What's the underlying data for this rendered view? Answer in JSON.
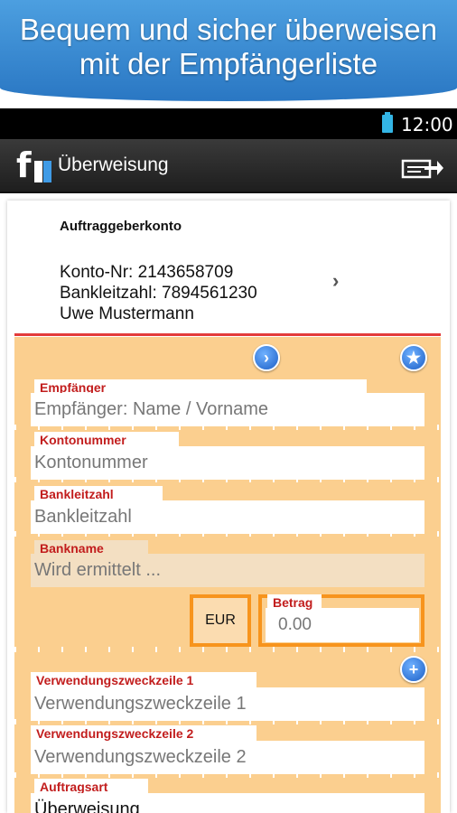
{
  "banner": {
    "line1": "Bequem und sicher überweisen",
    "line2": "mit der Empfängerliste"
  },
  "statusbar": {
    "time": "12:00",
    "battery_icon": "battery-icon"
  },
  "actionbar": {
    "title": "Überweisung",
    "logo_letter": "f"
  },
  "account": {
    "heading": "Auftraggeberkonto",
    "konto": "Konto-Nr: 2143658709",
    "blz": "Bankleitzahl: 7894561230",
    "name": "Uwe Mustermann"
  },
  "form": {
    "empfaenger": {
      "label": "Empfänger",
      "placeholder": "Empfänger: Name / Vorname"
    },
    "kontonummer": {
      "label": "Kontonummer",
      "placeholder": "Kontonummer"
    },
    "bankleitzahl": {
      "label": "Bankleitzahl",
      "placeholder": "Bankleitzahl"
    },
    "bankname": {
      "label": "Bankname",
      "value": "Wird ermittelt ..."
    },
    "currency": "EUR",
    "betrag": {
      "label": "Betrag",
      "placeholder": "0.00"
    },
    "vzw1": {
      "label": "Verwendungszweckzeile 1",
      "placeholder": "Verwendungszweckzeile 1"
    },
    "vzw2": {
      "label": "Verwendungszweckzeile 2",
      "placeholder": "Verwendungszweckzeile 2"
    },
    "auftragsart": {
      "label": "Auftragsart",
      "value": "Überweisung"
    }
  },
  "colors": {
    "accent_blue": "#2a77c3",
    "form_bg": "#fbcf8f",
    "label_red": "#c21d1d",
    "amount_border": "#f7941d"
  }
}
